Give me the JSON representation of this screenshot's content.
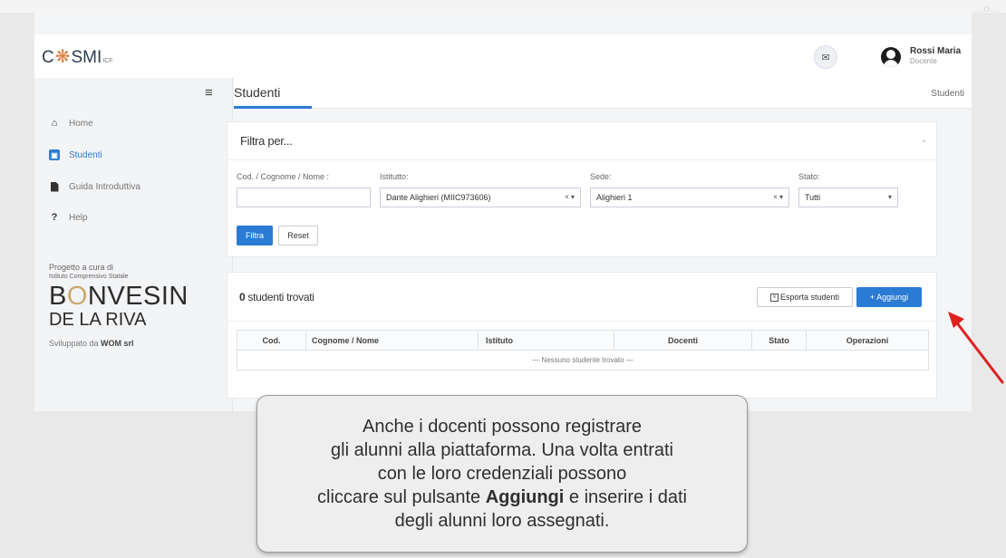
{
  "watermark": "…o…",
  "header": {
    "logo": {
      "prefix": "C",
      "glyph": "❋",
      "suffix": "SMI",
      "sub": "ICF"
    },
    "user": {
      "name": "Rossi Maria",
      "role": "Docente"
    }
  },
  "sidebar": {
    "items": [
      {
        "label": "Home",
        "icon": "home-icon"
      },
      {
        "label": "Studenti",
        "icon": "student-icon",
        "active": true
      },
      {
        "label": "Guida Introduttiva",
        "icon": "document-icon"
      },
      {
        "label": "Help",
        "icon": "question-icon"
      }
    ],
    "credit_line1": "Progetto a cura di",
    "credit_line2": "Istituto Comprensivo Statale",
    "school_name_b": "B",
    "school_name_o": "O",
    "school_name_rest": "NVESIN",
    "school_name_line2": "DE LA RIVA",
    "dev_prefix": "Sviluppato da ",
    "dev_company": "WOM srl"
  },
  "page": {
    "title": "Studenti",
    "breadcrumb": "Studenti"
  },
  "filter": {
    "title": "Filtra per...",
    "labels": {
      "code": "Cod. / Cognome / Nome :",
      "institute": "Istitutto:",
      "site": "Sede:",
      "state": "Stato:"
    },
    "values": {
      "code": "",
      "institute": "Dante Alighieri (MIIC973606)",
      "site": "Alighieri 1",
      "state": "Tutti"
    },
    "filter_button": "Filtra",
    "reset_button": "Reset"
  },
  "results": {
    "count": "0",
    "count_label": " studenti trovati",
    "export_button": "Esporta studenti",
    "add_button": "+ Aggiungi",
    "columns": [
      "Cod.",
      "Cognome / Nome",
      "Istituto",
      "Docenti",
      "Stato",
      "Operazioni"
    ],
    "empty_message": "— Nessuno studente trovato —"
  },
  "caption": {
    "line1": "Anche i docenti possono registrare",
    "line2": "gli alunni alla piattaforma. Una volta entrati",
    "line3": "con le loro credenziali possono",
    "line4_pre": "cliccare sul pulsante ",
    "line4_bold": "Aggiungi",
    "line4_post": " e inserire i dati",
    "line5": "degli alunni loro assegnati."
  },
  "colors": {
    "accent": "#2a7bd3",
    "arrow": "#e02020"
  }
}
